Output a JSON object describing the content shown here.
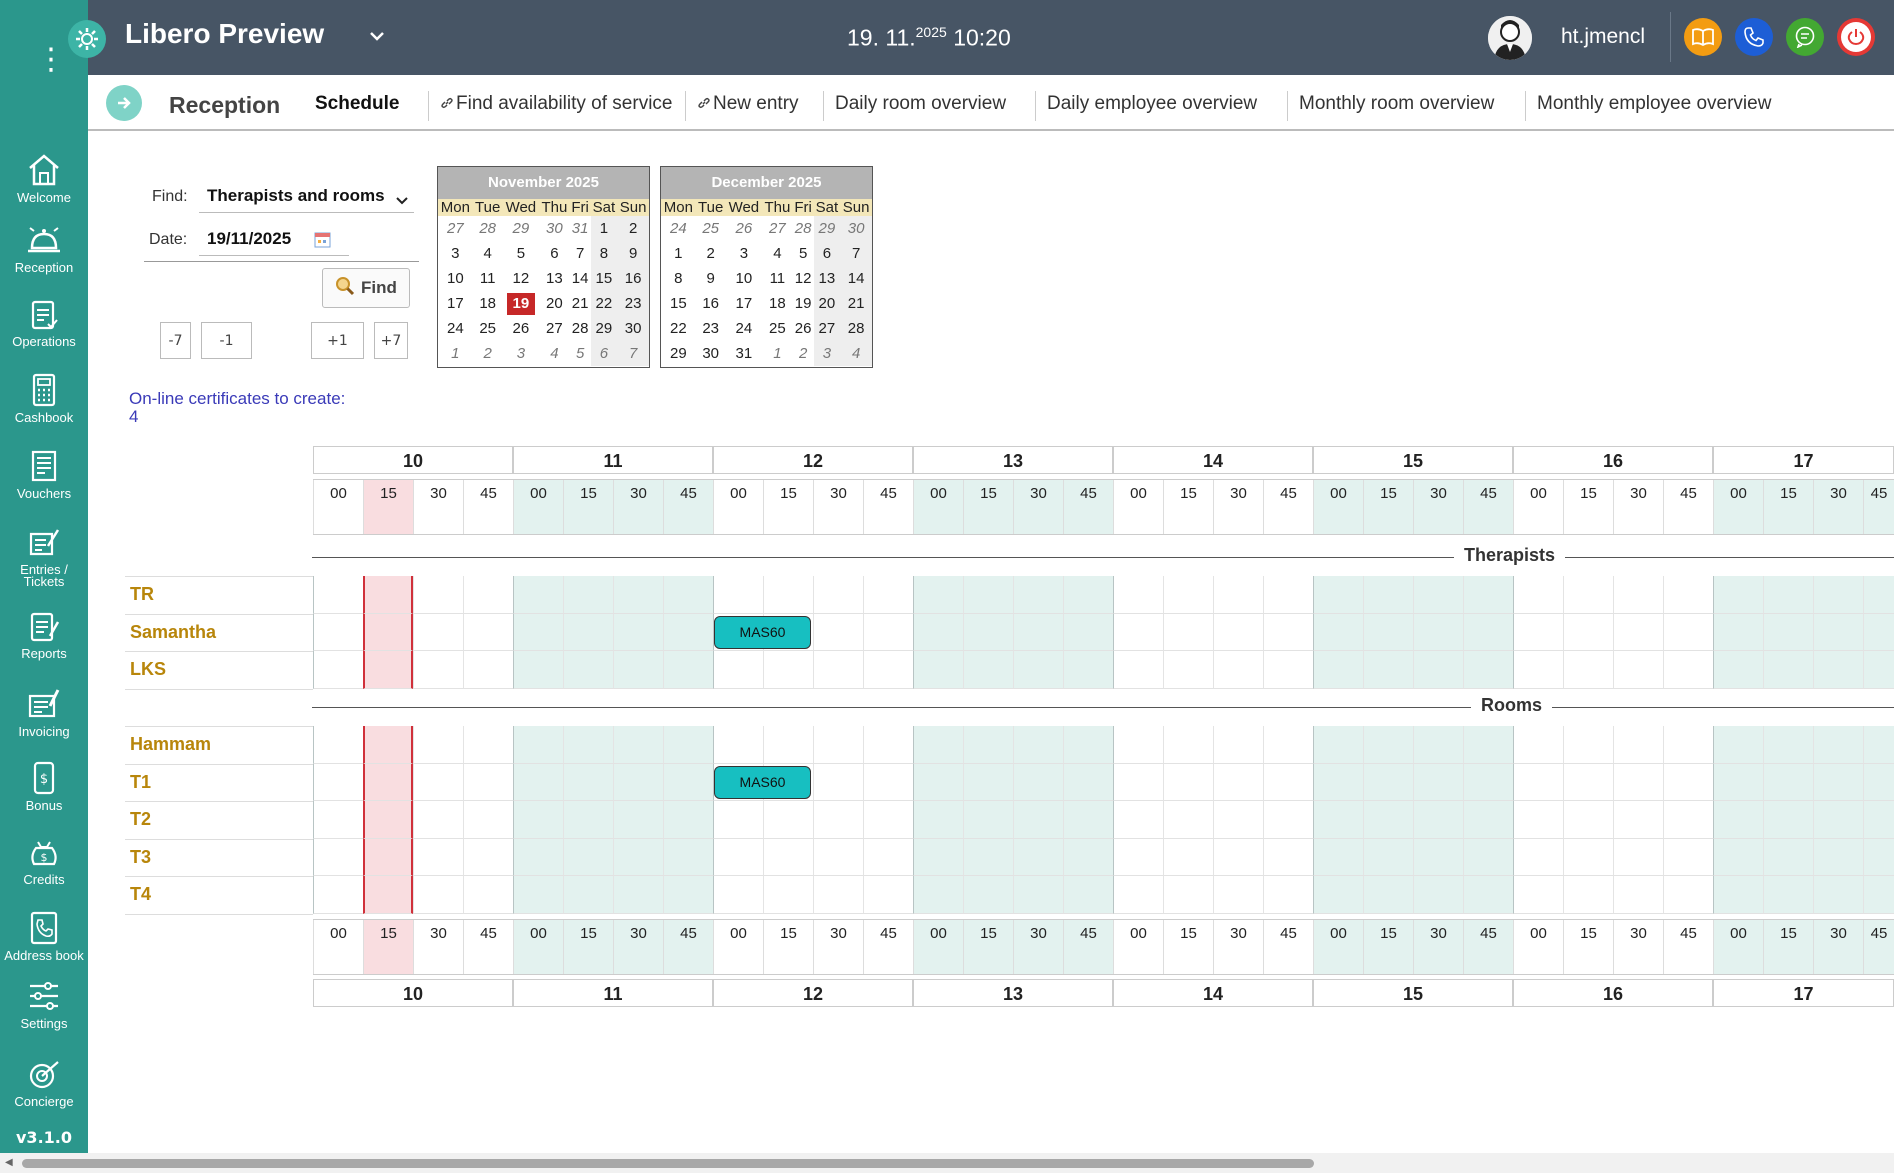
{
  "app": {
    "title": "Libero Preview",
    "datetime_date": "19. 11.",
    "datetime_year": "2025",
    "datetime_time": "10:20",
    "user": "ht.jmencl",
    "version": "v3.1.0"
  },
  "sidebar": {
    "items": [
      {
        "label": "Welcome",
        "icon": "home-icon"
      },
      {
        "label": "Reception",
        "icon": "bell-icon"
      },
      {
        "label": "Operations",
        "icon": "clipboard-icon"
      },
      {
        "label": "Cashbook",
        "icon": "calculator-icon"
      },
      {
        "label": "Vouchers",
        "icon": "voucher-icon"
      },
      {
        "label": "Entries / Tickets",
        "icon": "ticket-icon"
      },
      {
        "label": "Reports",
        "icon": "report-icon"
      },
      {
        "label": "Invoicing",
        "icon": "invoice-icon"
      },
      {
        "label": "Bonus",
        "icon": "bonus-icon"
      },
      {
        "label": "Credits",
        "icon": "credits-icon"
      },
      {
        "label": "Address book",
        "icon": "address-book-icon"
      },
      {
        "label": "Settings",
        "icon": "sliders-icon"
      },
      {
        "label": "Concierge",
        "icon": "concierge-icon"
      }
    ]
  },
  "tabs": {
    "section": "Reception",
    "items": [
      "Schedule",
      "Find availability of service",
      "New entry",
      "Daily room overview",
      "Daily employee overview",
      "Monthly room overview",
      "Monthly employee overview"
    ]
  },
  "form": {
    "find_label": "Find:",
    "find_value": "Therapists and rooms",
    "date_label": "Date:",
    "date_value": "19/11/2025",
    "find_button": "Find",
    "step_buttons": [
      "-7",
      "-1",
      "+1",
      "+7"
    ],
    "certificates": "On-line certificates to create: 4"
  },
  "calendars": [
    {
      "title": "November 2025",
      "weekdays": [
        "Mon",
        "Tue",
        "Wed",
        "Thu",
        "Fri",
        "Sat",
        "Sun"
      ],
      "weeks": [
        [
          "27",
          "28",
          "29",
          "30",
          "31",
          "1",
          "2"
        ],
        [
          "3",
          "4",
          "5",
          "6",
          "7",
          "8",
          "9"
        ],
        [
          "10",
          "11",
          "12",
          "13",
          "14",
          "15",
          "16"
        ],
        [
          "17",
          "18",
          "19",
          "20",
          "21",
          "22",
          "23"
        ],
        [
          "24",
          "25",
          "26",
          "27",
          "28",
          "29",
          "30"
        ],
        [
          "1",
          "2",
          "3",
          "4",
          "5",
          "6",
          "7"
        ]
      ],
      "other_month": {
        "first_week": [
          0,
          1,
          2,
          3,
          4
        ],
        "last_week": [
          0,
          1,
          2,
          3,
          4,
          5,
          6
        ]
      },
      "today": "19"
    },
    {
      "title": "December 2025",
      "weekdays": [
        "Mon",
        "Tue",
        "Wed",
        "Thu",
        "Fri",
        "Sat",
        "Sun"
      ],
      "weeks": [
        [
          "24",
          "25",
          "26",
          "27",
          "28",
          "29",
          "30"
        ],
        [
          "1",
          "2",
          "3",
          "4",
          "5",
          "6",
          "7"
        ],
        [
          "8",
          "9",
          "10",
          "11",
          "12",
          "13",
          "14"
        ],
        [
          "15",
          "16",
          "17",
          "18",
          "19",
          "20",
          "21"
        ],
        [
          "22",
          "23",
          "24",
          "25",
          "26",
          "27",
          "28"
        ],
        [
          "29",
          "30",
          "31",
          "1",
          "2",
          "3",
          "4"
        ]
      ],
      "other_month": {
        "first_week": [
          0,
          1,
          2,
          3,
          4,
          5,
          6
        ],
        "last_week": [
          3,
          4,
          5,
          6
        ]
      },
      "today": null
    }
  ],
  "schedule": {
    "hours": [
      "10",
      "11",
      "12",
      "13",
      "14",
      "15",
      "16",
      "17"
    ],
    "minutes": [
      "00",
      "15",
      "30",
      "45"
    ],
    "current_slot": "10:15",
    "sections": [
      {
        "label": "Therapists",
        "rows": [
          "TR",
          "Samantha",
          "LKS"
        ]
      },
      {
        "label": "Rooms",
        "rows": [
          "Hammam",
          "T1",
          "T2",
          "T3",
          "T4"
        ]
      }
    ],
    "appointments": [
      {
        "row": "Samantha",
        "start": "12:00",
        "label": "MAS60"
      },
      {
        "row": "T1",
        "start": "12:00",
        "label": "MAS60"
      }
    ]
  },
  "colors": {
    "sidebar": "#2b978c",
    "header": "#475565",
    "alt_hour_bg": "#e3f2ef",
    "current_slot_bg": "#f9dde0",
    "current_slot_line": "#d0303a",
    "appointment": "#17bfc1",
    "row_label": "#b8860b"
  }
}
